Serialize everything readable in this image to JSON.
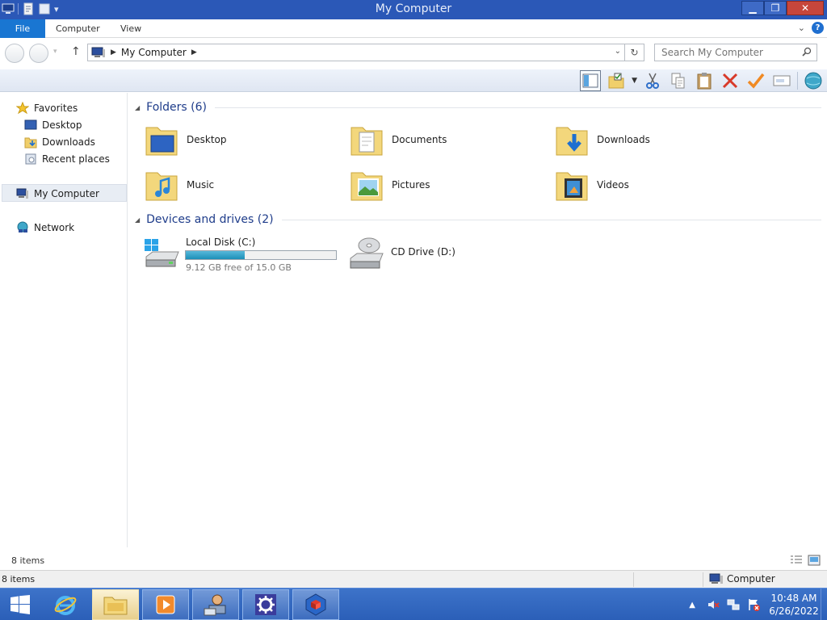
{
  "window": {
    "title": "My Computer"
  },
  "ribbon": {
    "tabs": [
      "File",
      "Computer",
      "View"
    ]
  },
  "address": {
    "location": "My Computer",
    "search_placeholder": "Search My Computer"
  },
  "nav": {
    "favorites": "Favorites",
    "favorite_items": [
      "Desktop",
      "Downloads",
      "Recent places"
    ],
    "computer": "My Computer",
    "network": "Network"
  },
  "content": {
    "folders_header": "Folders (6)",
    "folders": [
      "Desktop",
      "Documents",
      "Downloads",
      "Music",
      "Pictures",
      "Videos"
    ],
    "drives_header": "Devices and drives (2)",
    "drives": [
      {
        "name": "Local Disk (C:)",
        "free_text": "9.12 GB free of 15.0 GB",
        "used_fraction": 0.39
      },
      {
        "name": "CD Drive (D:)"
      }
    ]
  },
  "status": {
    "items_count": "8 items",
    "zone": "Computer"
  },
  "taskbar": {
    "time": "10:48 AM",
    "date": "6/26/2022"
  },
  "colors": {
    "accent": "#1976d2",
    "titlebar": "#2b58b7",
    "taskbar": "#3167c0",
    "drive_fill": "#1c8fb8"
  }
}
